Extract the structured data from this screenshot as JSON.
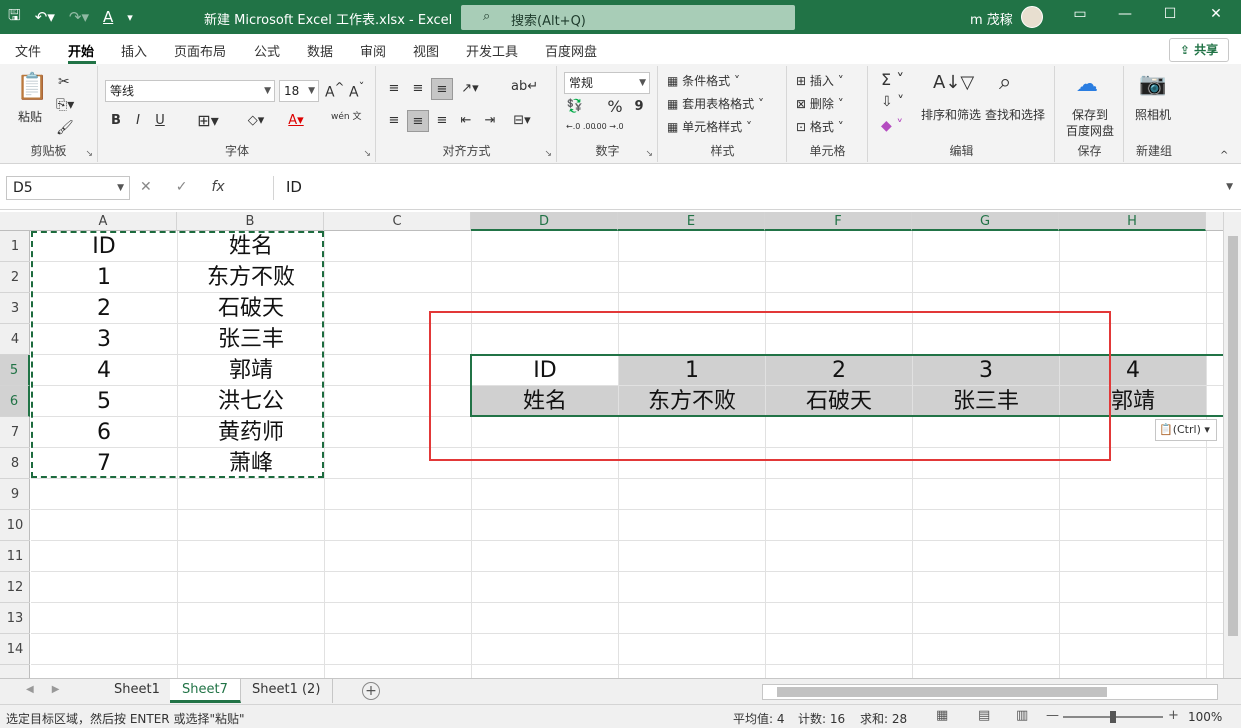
{
  "titlebar": {
    "doc_title": "新建 Microsoft Excel 工作表.xlsx  -  Excel",
    "search_placeholder": "搜索(Alt+Q)",
    "user": "m 茂稼",
    "qat": [
      "💾",
      "↶",
      "↷",
      "A",
      "▾"
    ]
  },
  "tabs": [
    "文件",
    "开始",
    "插入",
    "页面布局",
    "公式",
    "数据",
    "审阅",
    "视图",
    "开发工具",
    "百度网盘"
  ],
  "share_label": "共享",
  "ribbon": {
    "clipboard": {
      "paste": "粘贴",
      "label": "剪贴板"
    },
    "font": {
      "name": "等线",
      "size": "18",
      "label": "字体",
      "bold": "B",
      "italic": "I",
      "underline": "U",
      "grow": "A^",
      "shrink": "Aˇ",
      "wen": "wén 文"
    },
    "alignment": {
      "label": "对齐方式"
    },
    "number": {
      "format": "常规",
      "label": "数字",
      "percent": "%",
      "comma": "9",
      "inc": "←.0 .00",
      "dec": ".00 →.0"
    },
    "styles": {
      "conditional": "条件格式",
      "table": "套用表格格式",
      "cell": "单元格样式",
      "label": "样式"
    },
    "cells": {
      "insert": "插入",
      "delete": "删除",
      "format": "格式",
      "label": "单元格"
    },
    "editing": {
      "sort": "排序和筛选",
      "find": "查找和选择",
      "label": "编辑"
    },
    "save": {
      "btn_line1": "保存到",
      "btn_line2": "百度网盘",
      "label": "保存"
    },
    "newgroup": {
      "camera": "照相机",
      "label": "新建组"
    }
  },
  "formula_bar": {
    "name_box": "D5",
    "formula": "ID",
    "cancel": "✕",
    "enter": "✓",
    "fx": "fx"
  },
  "columns": [
    "A",
    "B",
    "C",
    "D",
    "E",
    "F",
    "G",
    "H"
  ],
  "rows": [
    "1",
    "2",
    "3",
    "4",
    "5",
    "6",
    "7",
    "8",
    "9",
    "10",
    "11",
    "12",
    "13",
    "14"
  ],
  "source_table": {
    "header": [
      "ID",
      "姓名"
    ],
    "rows": [
      [
        "1",
        "东方不败"
      ],
      [
        "2",
        "石破天"
      ],
      [
        "3",
        "张三丰"
      ],
      [
        "4",
        "郭靖"
      ],
      [
        "5",
        "洪七公"
      ],
      [
        "6",
        "黄药师"
      ],
      [
        "7",
        "萧峰"
      ]
    ]
  },
  "transposed": {
    "row5": [
      "ID",
      "1",
      "2",
      "3",
      "4"
    ],
    "row6": [
      "姓名",
      "东方不败",
      "石破天",
      "张三丰",
      "郭靖"
    ]
  },
  "paste_options": "(Ctrl)",
  "sheets": [
    "Sheet1",
    "Sheet7",
    "Sheet1 (2)"
  ],
  "active_sheet": "Sheet7",
  "status": {
    "message": "选定目标区域，然后按 ENTER 或选择\"粘贴\"",
    "average": "平均值: 4",
    "count": "计数: 16",
    "sum": "求和: 28",
    "zoom": "100%"
  },
  "colors": {
    "excel_green": "#217346",
    "highlight_red": "#e23838",
    "selection_gray": "#d0d0d0"
  }
}
